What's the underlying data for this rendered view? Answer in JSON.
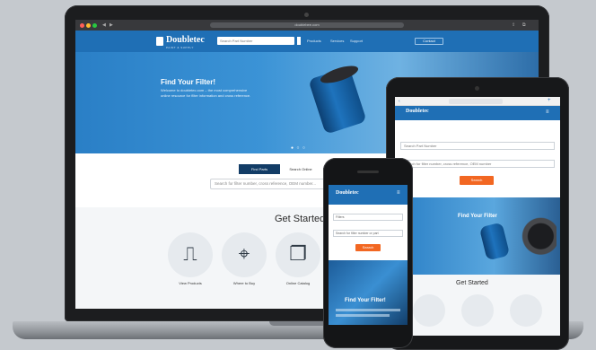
{
  "browser": {
    "url": "doublebee.com"
  },
  "site": {
    "logo": "Doubletec",
    "logo_sub": "PAINT & SUPPLY",
    "search_placeholder": "Search Part Number",
    "nav_links": [
      "Products",
      "Services",
      "Support"
    ],
    "nav_button": "Contact",
    "hero_title": "Find Your Filter!",
    "hero_lines": [
      "Welcome to doubletec.com – the most comprehensive",
      "online resource for filter information and cross reference."
    ],
    "search_tabs": [
      "Find Parts",
      "Search Online"
    ],
    "search_box_placeholder": "Search for filter number, cross reference, OEM number...",
    "get_started": "Get Started",
    "cards": [
      {
        "label": "View Products",
        "icon": "filter-icon"
      },
      {
        "label": "Where to Buy",
        "icon": "location-pin-icon"
      },
      {
        "label": "Online Catalog",
        "icon": "catalog-icon"
      }
    ]
  },
  "tablet": {
    "logo": "Doubletec",
    "search_placeholder": "Search Part Number",
    "cross_ref_placeholder": "Search for filter number, cross reference, OEM number",
    "button": "Search",
    "hero_title": "Find Your Filter",
    "get_started": "Get Started"
  },
  "phone": {
    "logo": "Doubletec",
    "select_value": "Filters",
    "field_placeholder": "Search for filter number or part",
    "button": "Search",
    "hero_title": "Find Your Filter!"
  }
}
